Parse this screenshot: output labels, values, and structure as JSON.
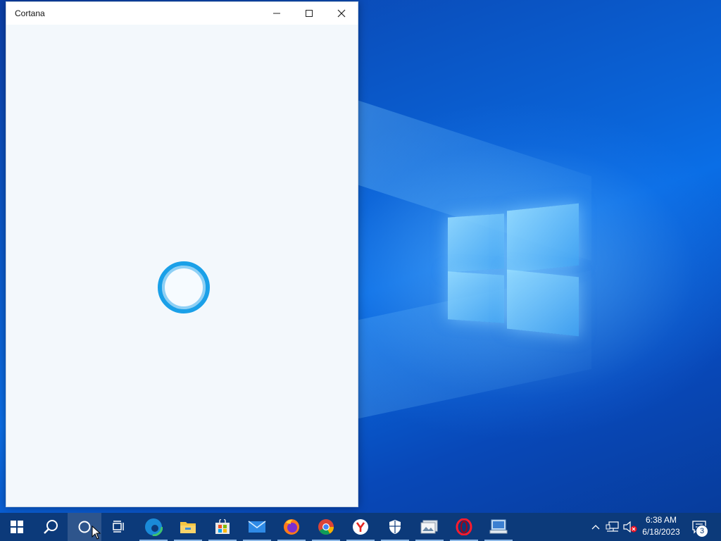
{
  "window": {
    "title": "Cortana",
    "buttons": [
      "minimize",
      "maximize",
      "close"
    ]
  },
  "taskbar": {
    "items": [
      {
        "name": "start",
        "icon": "windows-logo-icon"
      },
      {
        "name": "search",
        "icon": "search-icon"
      },
      {
        "name": "cortana",
        "icon": "cortana-icon",
        "active": true
      },
      {
        "name": "task-view",
        "icon": "task-view-icon"
      },
      {
        "name": "edge",
        "icon": "edge-icon",
        "open": true
      },
      {
        "name": "file-explorer",
        "icon": "folder-icon",
        "open": true
      },
      {
        "name": "microsoft-store",
        "icon": "store-icon",
        "open": true
      },
      {
        "name": "mail",
        "icon": "mail-icon",
        "open": true
      },
      {
        "name": "firefox",
        "icon": "firefox-icon",
        "open": true
      },
      {
        "name": "chrome",
        "icon": "chrome-icon",
        "open": true
      },
      {
        "name": "yandex",
        "icon": "yandex-icon",
        "open": true
      },
      {
        "name": "windows-security",
        "icon": "shield-icon",
        "open": true
      },
      {
        "name": "photos",
        "icon": "photos-icon",
        "open": true
      },
      {
        "name": "opera",
        "icon": "opera-icon",
        "open": true
      },
      {
        "name": "remote-desktop",
        "icon": "remote-desktop-icon",
        "open": true
      }
    ],
    "tray": {
      "time": "6:38 AM",
      "date": "6/18/2023",
      "notifications": "3"
    }
  },
  "colors": {
    "taskbar": "#0c3a7a",
    "cortana_ring": "#1aa0e8",
    "window_bg": "#f3f8fc"
  }
}
